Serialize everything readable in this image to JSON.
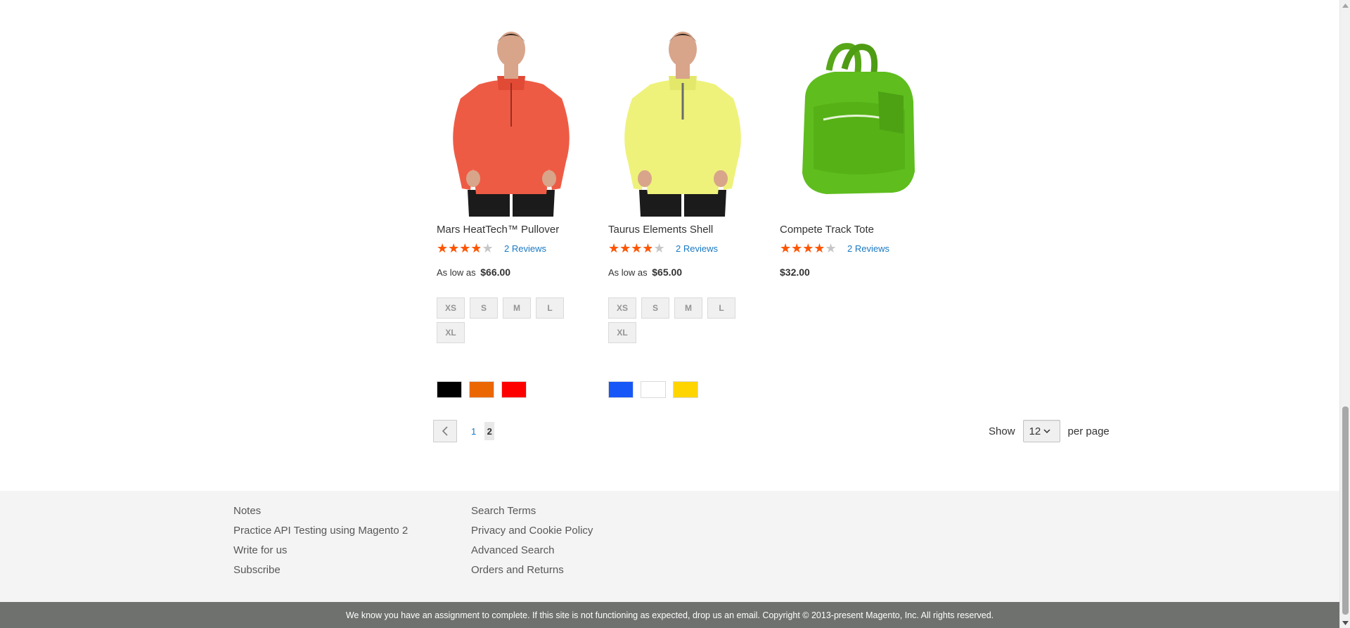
{
  "products": [
    {
      "name": "Mars HeatTech™ Pullover",
      "rating_percent": 70,
      "reviews": "2 Reviews",
      "price_prefix": "As low as",
      "price": "$66.00",
      "sizes": [
        "XS",
        "S",
        "M",
        "L",
        "XL"
      ],
      "colors": [
        "#000000",
        "#eb6703",
        "#ff0000"
      ],
      "image": "red-pullover-model"
    },
    {
      "name": "Taurus Elements Shell",
      "rating_percent": 70,
      "reviews": "2 Reviews",
      "price_prefix": "As low as",
      "price": "$65.00",
      "sizes": [
        "XS",
        "S",
        "M",
        "L",
        "XL"
      ],
      "colors": [
        "#1857f7",
        "#ffffff",
        "#ffd500"
      ],
      "image": "yellow-shell-model"
    },
    {
      "name": "Compete Track Tote",
      "rating_percent": 70,
      "reviews": "2 Reviews",
      "price": "$32.00",
      "image": "green-tote-bag"
    }
  ],
  "pager": {
    "prev_icon": "chevron-left-icon",
    "pages": [
      "1",
      "2"
    ],
    "current": "2"
  },
  "limiter": {
    "label_before": "Show",
    "selected": "12",
    "label_after": "per page"
  },
  "footer": {
    "col1": [
      "Notes",
      "Practice API Testing using Magento 2",
      "Write for us",
      "Subscribe"
    ],
    "col2": [
      "Search Terms",
      "Privacy and Cookie Policy",
      "Advanced Search",
      "Orders and Returns"
    ]
  },
  "copyright": "We know you have an assignment to complete. If this site is not functioning as expected, drop us an email. Copyright © 2013-present Magento, Inc. All rights reserved.",
  "colors": {
    "star": "#ff5501",
    "link": "#1979c3",
    "footer_bg": "#f4f4f4",
    "copyright_bg": "#6e716e"
  }
}
